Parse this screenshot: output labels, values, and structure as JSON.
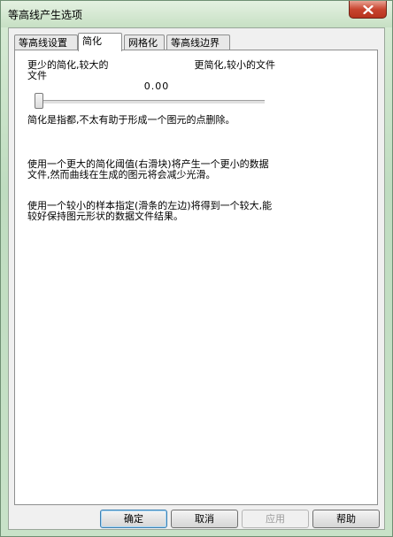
{
  "window": {
    "title": "等高线产生选项"
  },
  "tabs": [
    {
      "label": "等高线设置",
      "active": false
    },
    {
      "label": "简化",
      "active": true
    },
    {
      "label": "网格化",
      "active": false
    },
    {
      "label": "等高线边界",
      "active": false
    }
  ],
  "simplify": {
    "left_label": "更少的简化,较大的文件",
    "right_label": "更简化,较小的文件",
    "slider_value": "0.00",
    "description": "简化是指都,不太有助于形成一个图元的点删除。",
    "paragraph_1": "使用一个更大的简化阈值(右滑块)将产生一个更小的数据文件,然而曲线在生成的图元将会减少光滑。",
    "paragraph_2": "使用一个较小的样本指定(滑条的左边)将得到一个较大,能较好保持图元形状的数据文件结果。"
  },
  "buttons": {
    "ok": "确定",
    "cancel": "取消",
    "apply": "应用",
    "help": "帮助"
  }
}
